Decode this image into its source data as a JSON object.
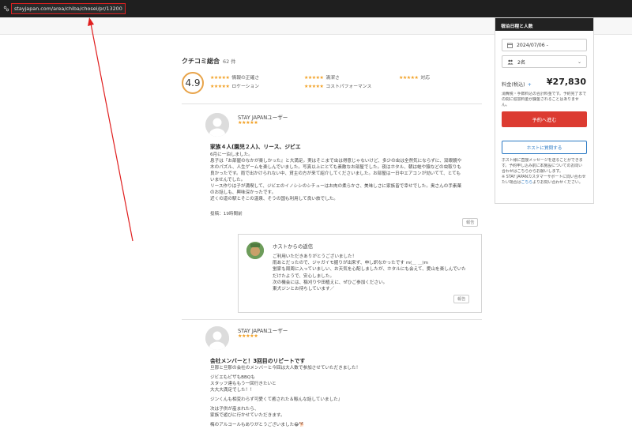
{
  "browser": {
    "url": "stayjapan.com/area/chiba/chosei/pr/13200"
  },
  "booking": {
    "header": "宿泊日程と人数",
    "date": "2024/07/06 -",
    "guests": "2名",
    "price_label": "料金(税込)",
    "price_plus": "+",
    "price": "¥27,830",
    "price_note": [
      "消費税・手数料込の合計料金です。予約完了まで",
      "の間に追加料金が課金されることはありませ",
      "ん。"
    ],
    "book_button": "予約へ進む",
    "contact_button": "ホストに質問する",
    "contact_note": [
      "ホスト様に直接メッセージを送ることができま",
      "す。予約申し込み前に本施設についてのお問い",
      "合わせはこちらからお願いします。",
      "※ STAY JAPANカスタマーサポートに問い合わせ",
      "たい場合は",
      {
        "text": "こちら"
      },
      "よりお問い合わせください。"
    ]
  },
  "reviews": {
    "title": "クチコミ総合",
    "count": "62 件",
    "score": "4.9",
    "stars": "★★★★★",
    "categories": [
      {
        "label": "情報の正確さ"
      },
      {
        "label": "清潔さ"
      },
      {
        "label": "対応"
      },
      {
        "label": "ロケーション"
      },
      {
        "label": "コストパフォーマンス"
      }
    ],
    "items": [
      {
        "user": "STAY JAPANユーザー",
        "stars": "★★★★★",
        "title": "家族４人(園児２人)、リース、ジビエ",
        "body": [
          "6月に一泊しました。",
          "息子は『お部屋のなかが楽しかった』と大満足。実はそこまで虫は得意じゃないけど、多少の虫は全然気にならずに、双眼鏡や",
          "木のパズル、人生ゲームを楽しんでいました。写真以上にとても素敵なお部屋でした。夜はホタル、朝は蛙や猿などの虫取りも",
          "良かったです。雨で出かけられない中、貸主の方が来て紹介してくださいました。お部屋は一日中エアコンが効いてて、とても",
          "いませんでした。",
          "リース作りは子が満喫して、ジビエのイノシシのシチューはお肉の柔らかさ、美味しさに家族皆で幸せでした。奥さんの手素菓",
          "のお話しも、興味深かったです。",
          "近くの道の駅とそこの温泉、そうの国も利用して良い旅でした。"
        ],
        "posted": "投稿：19時間前",
        "report": "報告",
        "host_reply": {
          "title": "ホストからの返信",
          "body": [
            "ご利用いただきありがとうございました！",
            "雨あとだったので、ジャガイモ掘りが出来ず、申し訳なかったです m(＿ ＿)m",
            "蛍家も周周に入っていましい、お天気を心配しましたが、ホタルにも会えて、愛山を楽しんでいた",
            "だけたようで、安心しました。",
            "次の機会には、稲刈りや田植えに、ぜひご参加ください。",
            "東犬ジンとお待ちしています／"
          ],
          "report": "報告"
        }
      },
      {
        "user": "STAY JAPANユーザー",
        "stars": "★★★★★",
        "title": "会社メンバーと！3回目のリピートです",
        "body": [
          "旦那と旦那の会社のメンバーと今回は大人数で参加させていただきました！",
          "",
          "ジビエもピザもBBQも",
          "スタッフ達ももう一回行きたいと",
          "大大大満足でした！！",
          "",
          "ジンくんも相変わらず可愛くて癒された＆賑んな話していました』",
          "",
          "次は子供が産まれたら、",
          "家族で遊びに行かせていただきます。",
          "",
          "梅のアルコールもありがとうございました😂🐕"
        ]
      }
    ]
  }
}
